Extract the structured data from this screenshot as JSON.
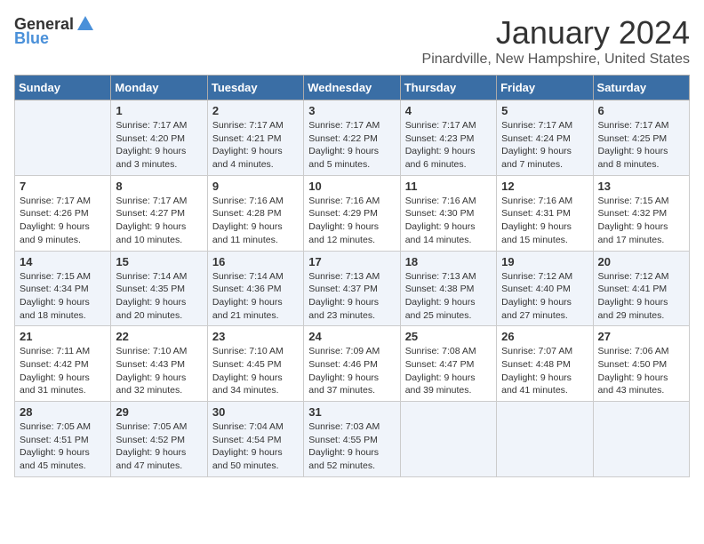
{
  "logo": {
    "general": "General",
    "blue": "Blue"
  },
  "title": "January 2024",
  "location": "Pinardville, New Hampshire, United States",
  "days_of_week": [
    "Sunday",
    "Monday",
    "Tuesday",
    "Wednesday",
    "Thursday",
    "Friday",
    "Saturday"
  ],
  "weeks": [
    [
      {
        "day": "",
        "content": ""
      },
      {
        "day": "1",
        "content": "Sunrise: 7:17 AM\nSunset: 4:20 PM\nDaylight: 9 hours\nand 3 minutes."
      },
      {
        "day": "2",
        "content": "Sunrise: 7:17 AM\nSunset: 4:21 PM\nDaylight: 9 hours\nand 4 minutes."
      },
      {
        "day": "3",
        "content": "Sunrise: 7:17 AM\nSunset: 4:22 PM\nDaylight: 9 hours\nand 5 minutes."
      },
      {
        "day": "4",
        "content": "Sunrise: 7:17 AM\nSunset: 4:23 PM\nDaylight: 9 hours\nand 6 minutes."
      },
      {
        "day": "5",
        "content": "Sunrise: 7:17 AM\nSunset: 4:24 PM\nDaylight: 9 hours\nand 7 minutes."
      },
      {
        "day": "6",
        "content": "Sunrise: 7:17 AM\nSunset: 4:25 PM\nDaylight: 9 hours\nand 8 minutes."
      }
    ],
    [
      {
        "day": "7",
        "content": "Sunrise: 7:17 AM\nSunset: 4:26 PM\nDaylight: 9 hours\nand 9 minutes."
      },
      {
        "day": "8",
        "content": "Sunrise: 7:17 AM\nSunset: 4:27 PM\nDaylight: 9 hours\nand 10 minutes."
      },
      {
        "day": "9",
        "content": "Sunrise: 7:16 AM\nSunset: 4:28 PM\nDaylight: 9 hours\nand 11 minutes."
      },
      {
        "day": "10",
        "content": "Sunrise: 7:16 AM\nSunset: 4:29 PM\nDaylight: 9 hours\nand 12 minutes."
      },
      {
        "day": "11",
        "content": "Sunrise: 7:16 AM\nSunset: 4:30 PM\nDaylight: 9 hours\nand 14 minutes."
      },
      {
        "day": "12",
        "content": "Sunrise: 7:16 AM\nSunset: 4:31 PM\nDaylight: 9 hours\nand 15 minutes."
      },
      {
        "day": "13",
        "content": "Sunrise: 7:15 AM\nSunset: 4:32 PM\nDaylight: 9 hours\nand 17 minutes."
      }
    ],
    [
      {
        "day": "14",
        "content": "Sunrise: 7:15 AM\nSunset: 4:34 PM\nDaylight: 9 hours\nand 18 minutes."
      },
      {
        "day": "15",
        "content": "Sunrise: 7:14 AM\nSunset: 4:35 PM\nDaylight: 9 hours\nand 20 minutes."
      },
      {
        "day": "16",
        "content": "Sunrise: 7:14 AM\nSunset: 4:36 PM\nDaylight: 9 hours\nand 21 minutes."
      },
      {
        "day": "17",
        "content": "Sunrise: 7:13 AM\nSunset: 4:37 PM\nDaylight: 9 hours\nand 23 minutes."
      },
      {
        "day": "18",
        "content": "Sunrise: 7:13 AM\nSunset: 4:38 PM\nDaylight: 9 hours\nand 25 minutes."
      },
      {
        "day": "19",
        "content": "Sunrise: 7:12 AM\nSunset: 4:40 PM\nDaylight: 9 hours\nand 27 minutes."
      },
      {
        "day": "20",
        "content": "Sunrise: 7:12 AM\nSunset: 4:41 PM\nDaylight: 9 hours\nand 29 minutes."
      }
    ],
    [
      {
        "day": "21",
        "content": "Sunrise: 7:11 AM\nSunset: 4:42 PM\nDaylight: 9 hours\nand 31 minutes."
      },
      {
        "day": "22",
        "content": "Sunrise: 7:10 AM\nSunset: 4:43 PM\nDaylight: 9 hours\nand 32 minutes."
      },
      {
        "day": "23",
        "content": "Sunrise: 7:10 AM\nSunset: 4:45 PM\nDaylight: 9 hours\nand 34 minutes."
      },
      {
        "day": "24",
        "content": "Sunrise: 7:09 AM\nSunset: 4:46 PM\nDaylight: 9 hours\nand 37 minutes."
      },
      {
        "day": "25",
        "content": "Sunrise: 7:08 AM\nSunset: 4:47 PM\nDaylight: 9 hours\nand 39 minutes."
      },
      {
        "day": "26",
        "content": "Sunrise: 7:07 AM\nSunset: 4:48 PM\nDaylight: 9 hours\nand 41 minutes."
      },
      {
        "day": "27",
        "content": "Sunrise: 7:06 AM\nSunset: 4:50 PM\nDaylight: 9 hours\nand 43 minutes."
      }
    ],
    [
      {
        "day": "28",
        "content": "Sunrise: 7:05 AM\nSunset: 4:51 PM\nDaylight: 9 hours\nand 45 minutes."
      },
      {
        "day": "29",
        "content": "Sunrise: 7:05 AM\nSunset: 4:52 PM\nDaylight: 9 hours\nand 47 minutes."
      },
      {
        "day": "30",
        "content": "Sunrise: 7:04 AM\nSunset: 4:54 PM\nDaylight: 9 hours\nand 50 minutes."
      },
      {
        "day": "31",
        "content": "Sunrise: 7:03 AM\nSunset: 4:55 PM\nDaylight: 9 hours\nand 52 minutes."
      },
      {
        "day": "",
        "content": ""
      },
      {
        "day": "",
        "content": ""
      },
      {
        "day": "",
        "content": ""
      }
    ]
  ]
}
